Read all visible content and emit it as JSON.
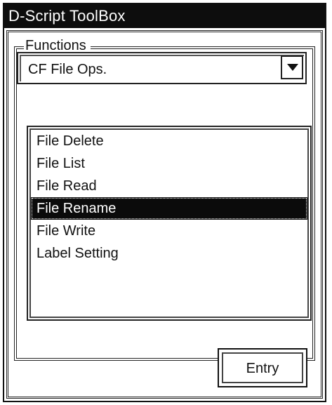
{
  "window": {
    "title": "D-Script ToolBox"
  },
  "functions_group": {
    "label": "Functions",
    "combo": {
      "selected": "CF File Ops."
    },
    "list": {
      "items": [
        "File Delete",
        "File List",
        "File Read",
        "File Rename",
        "File Write",
        "Label Setting"
      ],
      "selected_index": 3
    }
  },
  "entry_button": {
    "label": "Entry"
  }
}
